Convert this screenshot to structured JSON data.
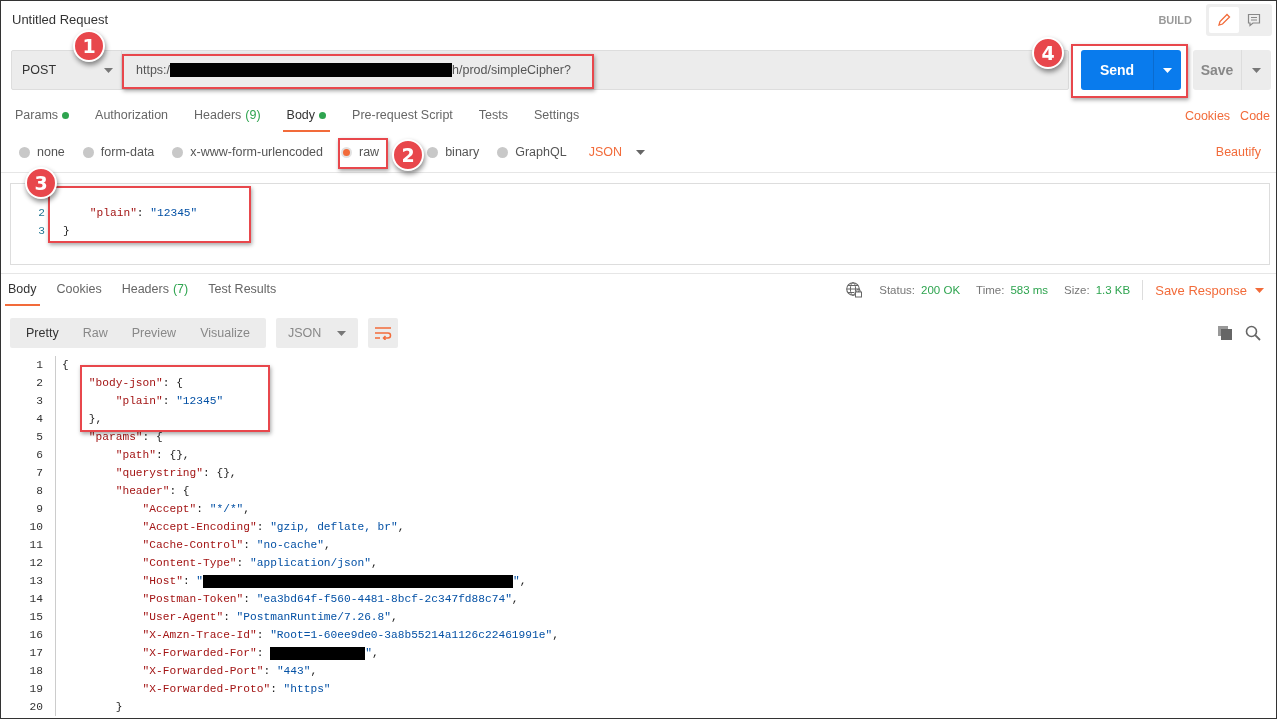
{
  "window": {
    "title": "Untitled Request"
  },
  "header": {
    "mode_label": "BUILD",
    "modes": [
      {
        "kind": "edit",
        "selected": true
      },
      {
        "kind": "comment",
        "selected": false
      }
    ]
  },
  "request": {
    "method": "POST",
    "url": {
      "prefix": "https:/",
      "redacted": true,
      "suffix": "h/prod/simpleCipher?"
    },
    "send": "Send",
    "save": "Save"
  },
  "request_tabs": [
    {
      "label": "Params",
      "dot": true,
      "selected": false
    },
    {
      "label": "Authorization",
      "dot": false,
      "selected": false
    },
    {
      "label": "Headers",
      "count": "(9)",
      "dot": false,
      "selected": false
    },
    {
      "label": "Body",
      "dot": true,
      "selected": true
    },
    {
      "label": "Pre-request Script",
      "dot": false,
      "selected": false
    },
    {
      "label": "Tests",
      "dot": false,
      "selected": false
    },
    {
      "label": "Settings",
      "dot": false,
      "selected": false
    }
  ],
  "request_links": [
    "Cookies",
    "Code"
  ],
  "body_types": [
    {
      "label": "none",
      "selected": false
    },
    {
      "label": "form-data",
      "selected": false
    },
    {
      "label": "x-www-form-urlencoded",
      "selected": false
    },
    {
      "label": "raw",
      "selected": true
    },
    {
      "label": "binary",
      "selected": false
    },
    {
      "label": "GraphQL",
      "selected": false
    }
  ],
  "body_format": "JSON",
  "beautify": "Beautify",
  "request_body": [
    {
      "number": "2",
      "code": "    \"plain\": \"12345\""
    },
    {
      "number": "3",
      "code": "}"
    }
  ],
  "response_tabs": [
    {
      "label": "Body",
      "selected": true
    },
    {
      "label": "Cookies",
      "selected": false
    },
    {
      "label": "Headers",
      "count": "(7)",
      "selected": false
    },
    {
      "label": "Test Results",
      "selected": false
    }
  ],
  "response_meta": [
    {
      "label": "Status:",
      "value": "200 OK"
    },
    {
      "label": "Time:",
      "value": "583 ms"
    },
    {
      "label": "Size:",
      "value": "1.3 KB"
    }
  ],
  "save_response": "Save Response",
  "view_modes": [
    {
      "label": "Pretty",
      "selected": true
    },
    {
      "label": "Raw",
      "selected": false
    },
    {
      "label": "Preview",
      "selected": false
    },
    {
      "label": "Visualize",
      "selected": false
    }
  ],
  "response_format": "JSON",
  "response_body": [
    {
      "number": "1",
      "code": "{"
    },
    {
      "number": "2",
      "code": "    \"body-json\": {"
    },
    {
      "number": "3",
      "code": "        \"plain\": \"12345\""
    },
    {
      "number": "4",
      "code": "    },"
    },
    {
      "number": "5",
      "code": "    \"params\": {"
    },
    {
      "number": "6",
      "code": "        \"path\": {},"
    },
    {
      "number": "7",
      "code": "        \"querystring\": {},"
    },
    {
      "number": "8",
      "code": "        \"header\": {"
    },
    {
      "number": "9",
      "code": "            \"Accept\": \"*/*\","
    },
    {
      "number": "10",
      "code": "            \"Accept-Encoding\": \"gzip, deflate, br\","
    },
    {
      "number": "11",
      "code": "            \"Cache-Control\": \"no-cache\","
    },
    {
      "number": "12",
      "code": "            \"Content-Type\": \"application/json\","
    },
    {
      "number": "13",
      "code": "            \"Host\": \"",
      "redacted": true,
      "tail": "\","
    },
    {
      "number": "14",
      "code": "            \"Postman-Token\": \"ea3bd64f-f560-4481-8bcf-2c347fd88c74\","
    },
    {
      "number": "15",
      "code": "            \"User-Agent\": \"PostmanRuntime/7.26.8\","
    },
    {
      "number": "16",
      "code": "            \"X-Amzn-Trace-Id\": \"Root=1-60ee9de0-3a8b55214a1126c22461991e\","
    },
    {
      "number": "17",
      "code": "            \"X-Forwarded-For\": ",
      "redacted": true,
      "tail": "\","
    },
    {
      "number": "18",
      "code": "            \"X-Forwarded-Port\": \"443\","
    },
    {
      "number": "19",
      "code": "            \"X-Forwarded-Proto\": \"https\""
    },
    {
      "number": "20",
      "code": "        }"
    }
  ],
  "callouts": [
    {
      "number": "1"
    },
    {
      "number": "2"
    },
    {
      "number": "3"
    },
    {
      "number": "4"
    }
  ]
}
